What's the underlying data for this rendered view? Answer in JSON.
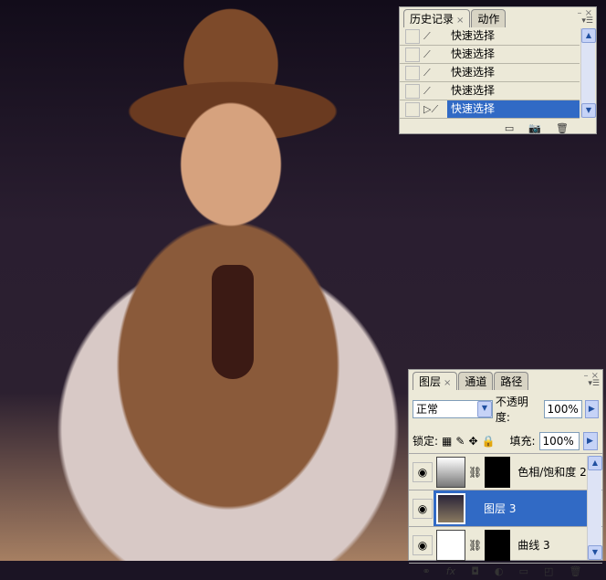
{
  "history_panel": {
    "tabs": [
      "历史记录",
      "动作"
    ],
    "items": [
      "快速选择",
      "快速选择",
      "快速选择",
      "快速选择",
      "快速选择"
    ],
    "selected_index": 4
  },
  "layers_panel": {
    "tabs": [
      "图层",
      "通道",
      "路径"
    ],
    "blend_mode": "正常",
    "opacity_label": "不透明度:",
    "opacity": "100%",
    "lock_label": "锁定:",
    "fill_label": "填充:",
    "fill": "100%",
    "layers": [
      {
        "name": "色相/饱和度 2",
        "type": "adjustment"
      },
      {
        "name": "图层 3",
        "type": "pixel",
        "selected": true
      },
      {
        "name": "曲线 3",
        "type": "adjustment"
      }
    ]
  },
  "colors": {
    "selection": "#316ac5",
    "panel": "#ece9d8"
  }
}
